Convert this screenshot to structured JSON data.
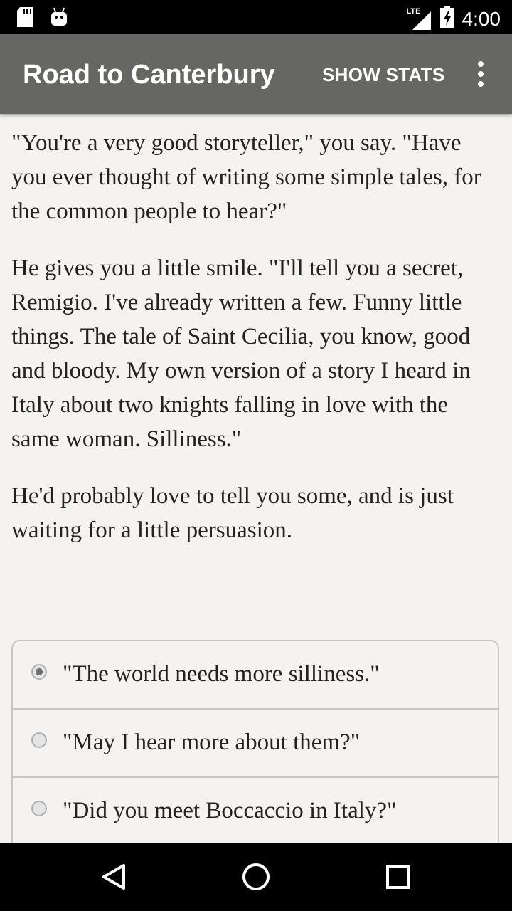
{
  "status_bar": {
    "time": "4:00",
    "network_label": "LTE",
    "icons": [
      "sd-card-icon",
      "android-icon",
      "signal-icon",
      "battery-icon"
    ]
  },
  "app_bar": {
    "title": "Road to Canterbury",
    "show_stats_label": "SHOW STATS",
    "menu_icon": "overflow-menu-icon",
    "background_color": "#666664"
  },
  "story": {
    "paragraphs": [
      "\"You're a very good storyteller,\" you say. \"Have you ever thought of writing some simple tales, for the common people to hear?\"",
      "He gives you a little smile. \"I'll tell you a secret, Remigio. I've already written a few. Funny little things. The tale of Saint Cecilia, you know, good and bloody. My own version of a story I heard in Italy about two knights falling in love with the same woman. Silliness.\"",
      "He'd probably love to tell you some, and is just waiting for a little persuasion."
    ]
  },
  "choices": [
    {
      "label": "\"The world needs more silliness.\"",
      "selected": true
    },
    {
      "label": "\"May I hear more about them?\"",
      "selected": false
    },
    {
      "label": "\"Did you meet Boccaccio in Italy?\"",
      "selected": false
    }
  ],
  "nav_bar": {
    "icons": [
      "back-icon",
      "home-icon",
      "recents-icon"
    ]
  }
}
